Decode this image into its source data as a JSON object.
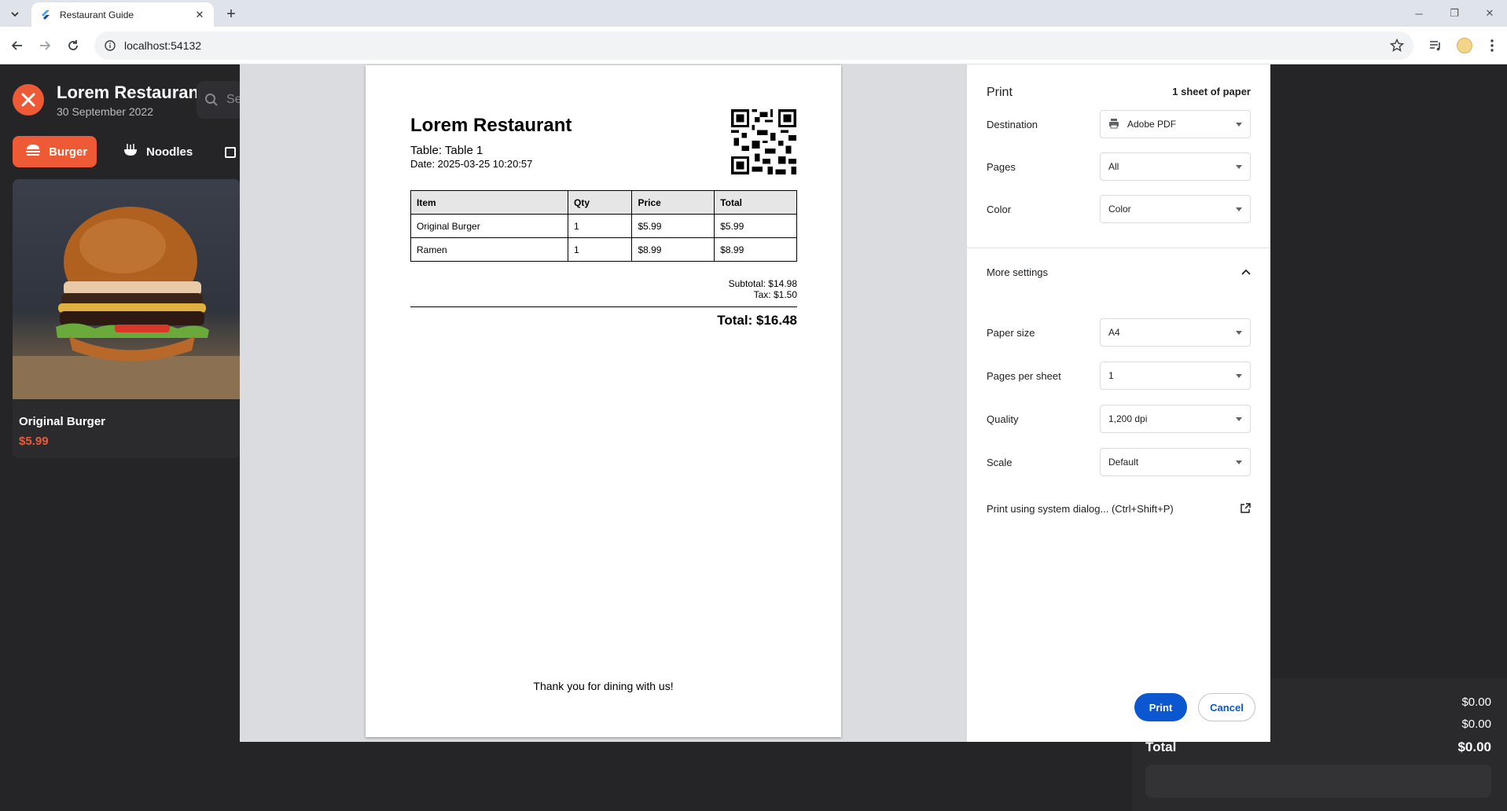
{
  "browser": {
    "tab_title": "Restaurant Guide",
    "url": "localhost:54132"
  },
  "app": {
    "name": "Lorem Restaurant",
    "date": "30 September 2022",
    "search_placeholder": "Se",
    "categories": [
      {
        "label": "Burger",
        "icon": "burger-icon",
        "active": true
      },
      {
        "label": "Noodles",
        "icon": "noodles-icon",
        "active": false
      }
    ],
    "food": {
      "name": "Original Burger",
      "price": "$5.99"
    },
    "order": {
      "subtotal": "$0.00",
      "tax": "$0.00",
      "total_label": "Total",
      "total": "$0.00"
    }
  },
  "receipt": {
    "title": "Lorem Restaurant",
    "table": "Table: Table 1",
    "date": "Date: 2025-03-25 10:20:57",
    "columns": [
      "Item",
      "Qty",
      "Price",
      "Total"
    ],
    "rows": [
      [
        "Original Burger",
        "1",
        "$5.99",
        "$5.99"
      ],
      [
        "Ramen",
        "1",
        "$8.99",
        "$8.99"
      ]
    ],
    "subtotal": "Subtotal: $14.98",
    "tax": "Tax: $1.50",
    "total": "Total: $16.48",
    "thanks": "Thank you for dining with us!"
  },
  "print": {
    "title": "Print",
    "sheets": "1 sheet of paper",
    "destination_label": "Destination",
    "destination": "Adobe PDF",
    "pages_label": "Pages",
    "pages": "All",
    "color_label": "Color",
    "color": "Color",
    "more_settings": "More settings",
    "paper_size_label": "Paper size",
    "paper_size": "A4",
    "pages_per_sheet_label": "Pages per sheet",
    "pages_per_sheet": "1",
    "quality_label": "Quality",
    "quality": "1,200 dpi",
    "scale_label": "Scale",
    "scale": "Default",
    "system_dialog": "Print using system dialog... (Ctrl+Shift+P)",
    "print_button": "Print",
    "cancel_button": "Cancel"
  }
}
